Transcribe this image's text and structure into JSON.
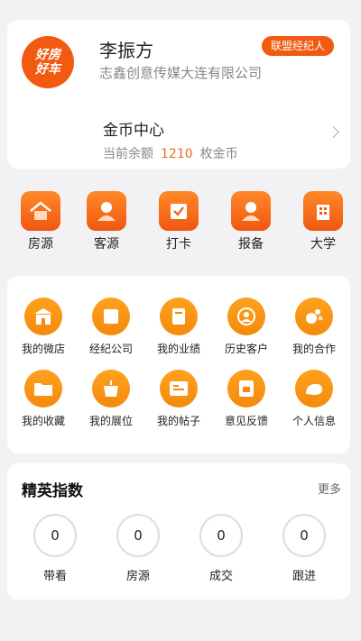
{
  "profile": {
    "logo_line1": "好房",
    "logo_line2": "好车",
    "name": "李振方",
    "company": "志鑫创意传媒大连有限公司",
    "badge": "联盟经纪人",
    "coin_title": "金币中心",
    "balance_label": "当前余额",
    "balance_value": "1210",
    "balance_unit": "枚金币"
  },
  "quick_nav": [
    {
      "label": "房源",
      "icon": "house-icon"
    },
    {
      "label": "客源",
      "icon": "person-icon"
    },
    {
      "label": "打卡",
      "icon": "check-in-icon"
    },
    {
      "label": "报备",
      "icon": "report-person-icon"
    },
    {
      "label": "大学",
      "icon": "building-icon"
    }
  ],
  "grid": [
    {
      "label": "我的微店",
      "icon": "shop-icon"
    },
    {
      "label": "经纪公司",
      "icon": "company-icon"
    },
    {
      "label": "我的业绩",
      "icon": "performance-icon"
    },
    {
      "label": "历史客户",
      "icon": "history-client-icon"
    },
    {
      "label": "我的合作",
      "icon": "cooperation-icon"
    },
    {
      "label": "我的收藏",
      "icon": "folder-icon"
    },
    {
      "label": "我的展位",
      "icon": "booth-icon"
    },
    {
      "label": "我的帖子",
      "icon": "post-icon"
    },
    {
      "label": "意见反馈",
      "icon": "feedback-icon"
    },
    {
      "label": "个人信息",
      "icon": "profile-icon"
    }
  ],
  "elite": {
    "title": "精英指数",
    "more": "更多",
    "stats": [
      {
        "label": "带看",
        "value": "0"
      },
      {
        "label": "房源",
        "value": "0"
      },
      {
        "label": "成交",
        "value": "0"
      },
      {
        "label": "跟进",
        "value": "0"
      }
    ]
  },
  "colors": {
    "accent": "#f25a12",
    "grid_icon": "#f38a0c",
    "background": "#f2f2f4"
  }
}
